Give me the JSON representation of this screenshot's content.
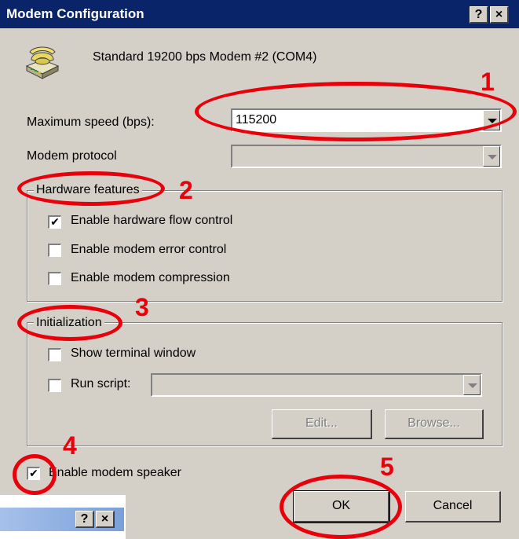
{
  "window": {
    "title": "Modem Configuration",
    "help_button": "?",
    "close_button": "×"
  },
  "modem": {
    "icon": "telephone-modem-icon",
    "name": "Standard 19200 bps Modem #2 (COM4)"
  },
  "max_speed": {
    "label": "Maximum speed (bps):",
    "value": "115200"
  },
  "protocol": {
    "label": "Modem protocol",
    "value": ""
  },
  "hardware": {
    "legend": "Hardware features",
    "options": [
      {
        "label": "Enable hardware flow control",
        "checked": true
      },
      {
        "label": "Enable modem error control",
        "checked": false
      },
      {
        "label": "Enable modem compression",
        "checked": false
      }
    ]
  },
  "initialization": {
    "legend": "Initialization",
    "show_terminal": {
      "label": "Show terminal window",
      "checked": false
    },
    "run_script": {
      "label": "Run script:",
      "checked": false,
      "value": ""
    },
    "edit_label": "Edit...",
    "browse_label": "Browse..."
  },
  "speaker": {
    "label": "Enable modem speaker",
    "checked": true
  },
  "buttons": {
    "ok": "OK",
    "cancel": "Cancel"
  },
  "annotations": [
    "1",
    "2",
    "3",
    "4",
    "5"
  ],
  "background_window": {
    "help_button": "?",
    "close_button": "×"
  },
  "colors": {
    "titlebar": "#0a246a",
    "dialog": "#d4d0c8",
    "annotation": "#e8000b"
  }
}
